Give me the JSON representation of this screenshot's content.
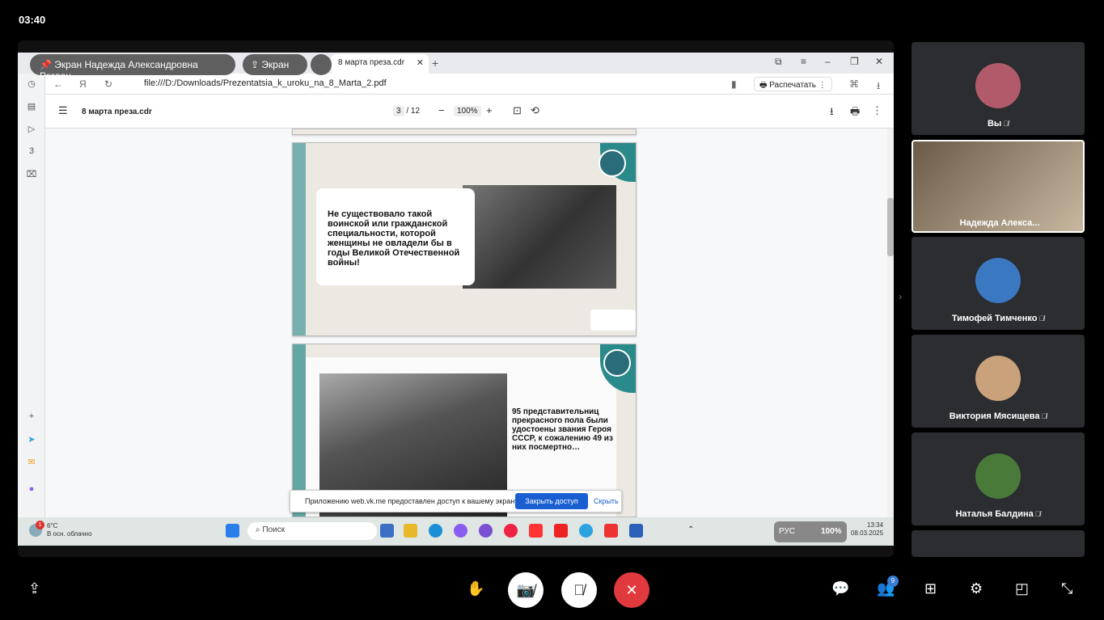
{
  "time": "03:40",
  "share_overlay": {
    "presenter_label": "Экран Надежда Александровна Резван",
    "screen_label": "Экран"
  },
  "browser": {
    "tab_title": "8 марта преза.cdr",
    "url": "file:///D:/Downloads/Prezentatsia_k_uroku_na_8_Marta_2.pdf",
    "print_label": "Распечатать"
  },
  "pdf": {
    "title": "8 марта преза.cdr",
    "current_page": "3",
    "total_pages": "/ 12",
    "zoom": "100%",
    "slide1_text": "Не существовало такой воинской или гражданской специальности, которой женщины не овладели бы в годы Великой Отечественной войны!",
    "slide2_text": "95 представительниц прекрасного пола были удостоены звания Героя СССР, к сожалению 49 из них посмертно…"
  },
  "notification": {
    "text": "Приложению web.vk.me предоставлен доступ к вашему экрану.",
    "close_button": "Закрыть доступ",
    "hide_button": "Скрыть"
  },
  "taskbar": {
    "weather_temp": "6°C",
    "weather_desc": "В осн. облачно",
    "weather_badge": "1",
    "search_placeholder": "Поиск",
    "lang": "РУС",
    "battery": "100%",
    "time": "13:34",
    "date": "08.03.2025"
  },
  "participants": [
    {
      "name": "Вы",
      "muted": true,
      "avatar_color": "#b05a6a"
    },
    {
      "name": "Надежда Алекса...",
      "muted": false,
      "avatar_color": "#9a8472"
    },
    {
      "name": "Тимофей Тимченко",
      "muted": true,
      "avatar_color": "#3a78c2"
    },
    {
      "name": "Виктория Мясищева",
      "muted": true,
      "avatar_color": "#c9a27c"
    },
    {
      "name": "Наталья Балдина",
      "muted": true,
      "avatar_color": "#4a7a3a"
    }
  ],
  "controls": {
    "participants_count": "9"
  },
  "colors": {
    "end_call": "#e0393e",
    "accent": "#1a5fd1",
    "teal": "#2a8a8a"
  }
}
